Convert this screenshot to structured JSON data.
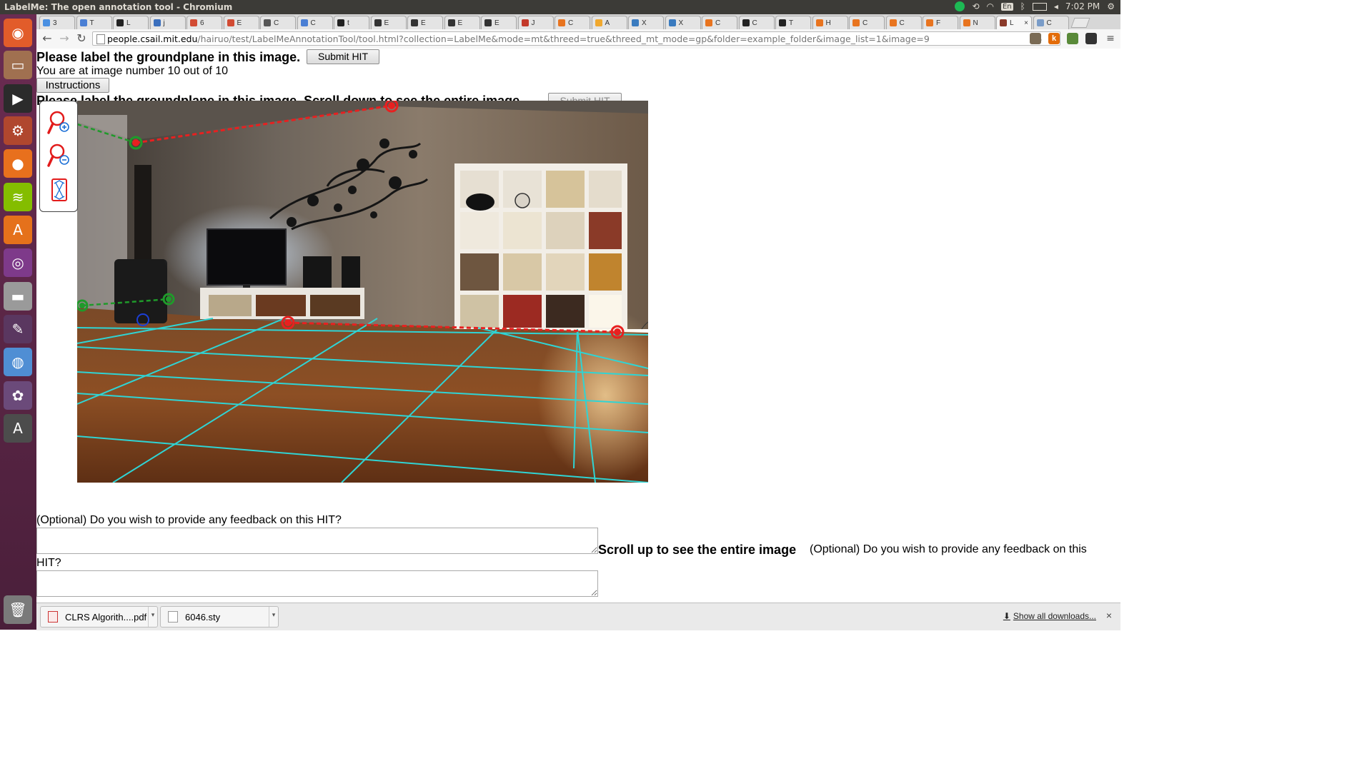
{
  "window": {
    "title": "LabelMe: The open annotation tool - Chromium",
    "clock": "7:02 PM",
    "keyboard_layout": "En"
  },
  "launcher": {
    "items": [
      {
        "name": "ubuntu-dash-icon",
        "color": "#e25c2a"
      },
      {
        "name": "files-icon",
        "color": "#a07050"
      },
      {
        "name": "terminal-icon",
        "color": "#2b2b2b"
      },
      {
        "name": "system-settings-icon",
        "color": "#b0472e"
      },
      {
        "name": "firefox-icon",
        "color": "#e8701d"
      },
      {
        "name": "spotify-icon",
        "color": "#84bd00"
      },
      {
        "name": "software-center-icon",
        "color": "#e5711b"
      },
      {
        "name": "app-ring-icon",
        "color": "#7e3a8a"
      },
      {
        "name": "disk-icon",
        "color": "#9a9a9a"
      },
      {
        "name": "text-editor-icon",
        "color": "#5a3760"
      },
      {
        "name": "chromium-icon",
        "color": "#4f8ed4"
      },
      {
        "name": "shotwell-icon",
        "color": "#6b4a7a"
      },
      {
        "name": "updater-icon",
        "color": "#4c4c4c"
      },
      {
        "name": "trash-icon",
        "color": "#7a7a7a"
      }
    ]
  },
  "tabs": [
    {
      "label": "3",
      "color": "#4a90e2"
    },
    {
      "label": "T",
      "color": "#4a7fd4"
    },
    {
      "label": "L",
      "color": "#222222"
    },
    {
      "label": "j",
      "color": "#3b6fbd"
    },
    {
      "label": "6",
      "color": "#d24b33"
    },
    {
      "label": "E",
      "color": "#d24b33"
    },
    {
      "label": "C",
      "color": "#555555"
    },
    {
      "label": "C",
      "color": "#4a7fd4"
    },
    {
      "label": "t",
      "color": "#222222"
    },
    {
      "label": "E",
      "color": "#333333"
    },
    {
      "label": "E",
      "color": "#333333"
    },
    {
      "label": "E",
      "color": "#333333"
    },
    {
      "label": "E",
      "color": "#333333"
    },
    {
      "label": "J",
      "color": "#c3392a"
    },
    {
      "label": "C",
      "color": "#e8741f"
    },
    {
      "label": "A",
      "color": "#f0a82e"
    },
    {
      "label": "X",
      "color": "#3a7bbf"
    },
    {
      "label": "X",
      "color": "#3a7bbf"
    },
    {
      "label": "C",
      "color": "#e8741f"
    },
    {
      "label": "C",
      "color": "#222222"
    },
    {
      "label": "T",
      "color": "#222222"
    },
    {
      "label": "H",
      "color": "#e8741f"
    },
    {
      "label": "C",
      "color": "#e8741f"
    },
    {
      "label": "C",
      "color": "#e8741f"
    },
    {
      "label": "F",
      "color": "#e8741f"
    },
    {
      "label": "N",
      "color": "#e8741f"
    },
    {
      "label": "L",
      "color": "#8a3a2a"
    },
    {
      "label": "C",
      "color": "#7a9cc8"
    }
  ],
  "toolbar": {
    "url_host": "people.csail.mit.edu",
    "url_path": "/hairuo/test/LabelMeAnnotationTool/tool.html?collection=LabelMe&mode=mt&threed=true&threed_mt_mode=gp&folder=example_folder&image_list=1&image=9",
    "extensions": [
      {
        "label": "",
        "color": "#7a6b55"
      },
      {
        "label": "k",
        "color": "#e36c09"
      },
      {
        "label": "",
        "color": "#5a8a3a"
      },
      {
        "label": "",
        "color": "#333333"
      }
    ]
  },
  "page": {
    "heading": "Please label the groundplane in this image.",
    "submit_label": "Submit HIT",
    "progress_text": "You are at image number 10 out of 10",
    "instructions_label": "Instructions",
    "scroll_heading": "Please label the groundplane in this image. Scroll down to see the entire image.",
    "submit_label_2": "Submit HIT",
    "feedback_question": "(Optional) Do you wish to provide any feedback on this HIT?",
    "scroll_up_heading": "Scroll up to see the entire image",
    "feedback_question_2_line1": "(Optional) Do you wish to provide any feedback on this",
    "feedback_question_2_line2": "HIT?",
    "feedback_value": "",
    "feedback_value_2": ""
  },
  "tools": [
    {
      "name": "zoom-in-icon"
    },
    {
      "name": "zoom-out-icon"
    },
    {
      "name": "fit-to-screen-icon"
    }
  ],
  "colors": {
    "grid": "#2fd4d4",
    "control_red": "#e82020",
    "control_green": "#1f9a2a",
    "control_blue": "#1c3fd6"
  },
  "downloads": {
    "items": [
      {
        "filename": "CLRS Algorith....pdf"
      },
      {
        "filename": "6046.sty"
      }
    ],
    "show_all": "Show all downloads...",
    "close": "×"
  }
}
